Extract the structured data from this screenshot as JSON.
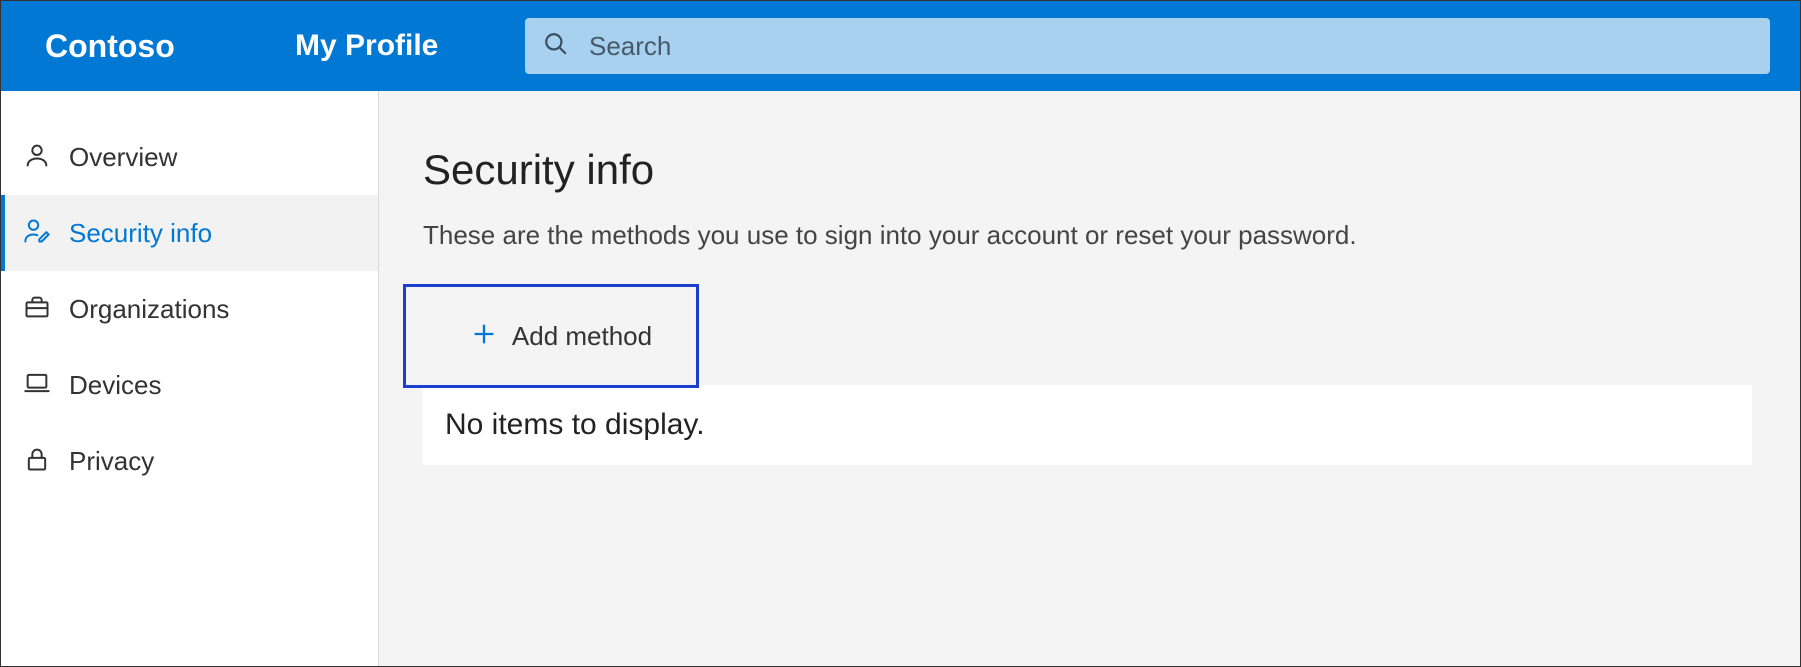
{
  "header": {
    "brand": "Contoso",
    "page_label": "My Profile",
    "search": {
      "placeholder": "Search",
      "value": ""
    }
  },
  "sidebar": {
    "items": [
      {
        "icon": "person-icon",
        "label": "Overview",
        "active": false
      },
      {
        "icon": "person-edit-icon",
        "label": "Security info",
        "active": true
      },
      {
        "icon": "briefcase-icon",
        "label": "Organizations",
        "active": false
      },
      {
        "icon": "laptop-icon",
        "label": "Devices",
        "active": false
      },
      {
        "icon": "lock-icon",
        "label": "Privacy",
        "active": false
      }
    ]
  },
  "main": {
    "title": "Security info",
    "subtitle": "These are the methods you use to sign into your account or reset your password.",
    "add_button_label": "Add method",
    "empty_text": "No items to display."
  }
}
